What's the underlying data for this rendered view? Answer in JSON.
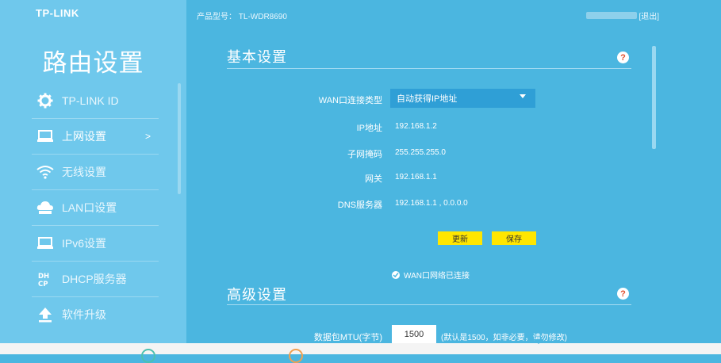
{
  "brand": {
    "logo": "TP-LINK"
  },
  "header": {
    "model_label": "产品型号：",
    "model": "TL-WDR8690",
    "logout": "[退出]"
  },
  "sidebar": {
    "title": "路由设置",
    "items": [
      {
        "label": "TP-LINK ID",
        "icon": "gear-icon"
      },
      {
        "label": "上网设置",
        "icon": "computer-icon",
        "active": true,
        "arrow": ">"
      },
      {
        "label": "无线设置",
        "icon": "wifi-icon"
      },
      {
        "label": "LAN口设置",
        "icon": "cloud-network-icon"
      },
      {
        "label": "IPv6设置",
        "icon": "monitor-icon"
      },
      {
        "label": "DHCP服务器",
        "icon": "dhcp-icon"
      },
      {
        "label": "软件升级",
        "icon": "upload-icon"
      }
    ]
  },
  "basic": {
    "title": "基本设置",
    "help": "?",
    "wan_type_label": "WAN口连接类型",
    "wan_type_value": "自动获得IP地址",
    "ip_label": "IP地址",
    "ip_value": "192.168.1.2",
    "mask_label": "子网掩码",
    "mask_value": "255.255.255.0",
    "gateway_label": "网关",
    "gateway_value": "192.168.1.1",
    "dns_label": "DNS服务器",
    "dns_value": "192.168.1.1 , 0.0.0.0",
    "refresh_button": "更新",
    "save_button": "保存",
    "status": "WAN口网络已连接"
  },
  "advanced": {
    "title": "高级设置",
    "help": "?",
    "mtu_label": "数据包MTU(字节)",
    "mtu_value": "1500",
    "mtu_hint": "(默认是1500，如非必要，请勿修改)"
  },
  "colors": {
    "background": "#4bb6e0",
    "sidebar": "#6fc8ec",
    "select": "#2f9fd6",
    "button": "#ffe600",
    "help_mark": "#e0502f"
  }
}
